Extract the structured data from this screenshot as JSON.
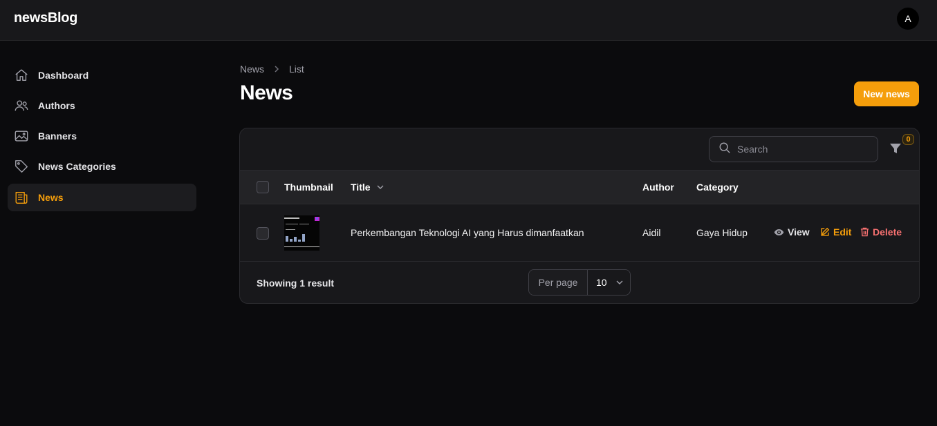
{
  "app": {
    "brand": "newsBlog",
    "avatar_initial": "A"
  },
  "sidebar": {
    "items": [
      {
        "label": "Dashboard",
        "icon": "home-icon"
      },
      {
        "label": "Authors",
        "icon": "users-icon"
      },
      {
        "label": "Banners",
        "icon": "image-icon"
      },
      {
        "label": "News Categories",
        "icon": "tag-icon"
      },
      {
        "label": "News",
        "icon": "newspaper-icon",
        "active": true
      }
    ]
  },
  "breadcrumb": {
    "parent": "News",
    "current": "List"
  },
  "page": {
    "title": "News",
    "new_button": "New news"
  },
  "toolbar": {
    "search_placeholder": "Search",
    "filter_count": "0"
  },
  "table": {
    "columns": {
      "thumbnail": "Thumbnail",
      "title": "Title",
      "author": "Author",
      "category": "Category"
    },
    "rows": [
      {
        "title": "Perkembangan Teknologi AI yang Harus dimanfaatkan",
        "author": "Aidil",
        "category": "Gaya Hidup"
      }
    ],
    "actions": {
      "view": "View",
      "edit": "Edit",
      "delete": "Delete"
    }
  },
  "footer": {
    "result_text": "Showing 1 result",
    "per_page_label": "Per page",
    "per_page_value": "10"
  },
  "colors": {
    "accent": "#f59e0b",
    "danger": "#f87171",
    "background": "#0b0b0d",
    "surface": "#18181b"
  }
}
